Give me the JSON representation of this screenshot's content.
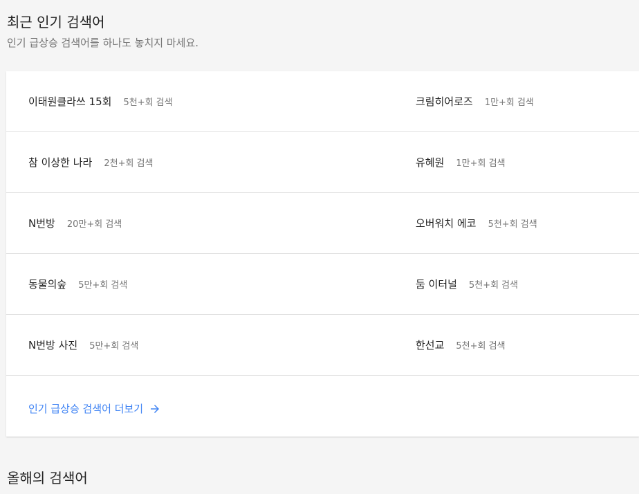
{
  "recent": {
    "title": "최근 인기 검색어",
    "subtitle": "인기 급상승 검색어를 하나도 놓치지 마세요.",
    "rows": [
      {
        "left": {
          "term": "이태원클라쓰 15회",
          "count": "5천+회 검색"
        },
        "right": {
          "term": "크림히어로즈",
          "count": "1만+회 검색"
        }
      },
      {
        "left": {
          "term": "참 이상한 나라",
          "count": "2천+회 검색"
        },
        "right": {
          "term": "유혜원",
          "count": "1만+회 검색"
        }
      },
      {
        "left": {
          "term": "N번방",
          "count": "20만+회 검색"
        },
        "right": {
          "term": "오버워치 에코",
          "count": "5천+회 검색"
        }
      },
      {
        "left": {
          "term": "동물의숲",
          "count": "5만+회 검색"
        },
        "right": {
          "term": "둠 이터널",
          "count": "5천+회 검색"
        }
      },
      {
        "left": {
          "term": "N번방 사진",
          "count": "5만+회 검색"
        },
        "right": {
          "term": "한선교",
          "count": "5천+회 검색"
        }
      }
    ],
    "more_label": "인기 급상승 검색어 더보기",
    "more_icon": "arrow-right-icon"
  },
  "yearly": {
    "title": "올해의 검색어"
  },
  "colors": {
    "link": "#4285f4",
    "background": "#f5f5f5",
    "card": "#ffffff",
    "divider": "#e0e0e0"
  }
}
